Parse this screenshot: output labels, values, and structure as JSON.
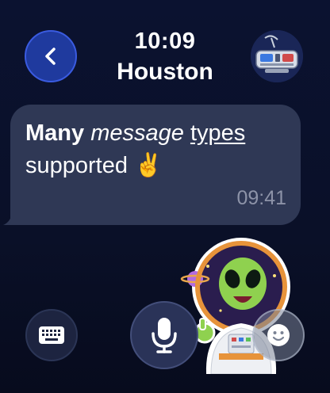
{
  "header": {
    "time": "10:09",
    "contact_name": "Houston"
  },
  "message": {
    "word_bold": "Many",
    "word_italic": "message",
    "word_underline": "types",
    "line2_text": "supported",
    "emoji": "✌️",
    "timestamp": "09:41"
  },
  "icons": {
    "back": "chevron-left-icon",
    "avatar": "satellite-icon",
    "keyboard": "keyboard-icon",
    "mic": "microphone-icon",
    "emoji": "smiley-icon"
  },
  "colors": {
    "background": "#0b1230",
    "bubble": "#2f3855",
    "accent": "#1f3a9e",
    "timestamp": "#8d93a8"
  }
}
